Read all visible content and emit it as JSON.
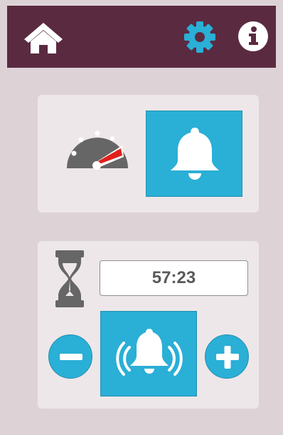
{
  "header": {
    "background": "#5a2a40",
    "icons": [
      "home-icon",
      "gear-icon",
      "info-icon"
    ]
  },
  "colors": {
    "accent": "#2aafd6",
    "icon_gray": "#666666",
    "gauge_needle": "#e0201c"
  },
  "speed_panel": {
    "icons": [
      "speedometer-icon",
      "bell-icon"
    ]
  },
  "timer_panel": {
    "time": "57:23",
    "icons": [
      "hourglass-icon",
      "minus-icon",
      "ringing-bell-icon",
      "plus-icon"
    ]
  }
}
